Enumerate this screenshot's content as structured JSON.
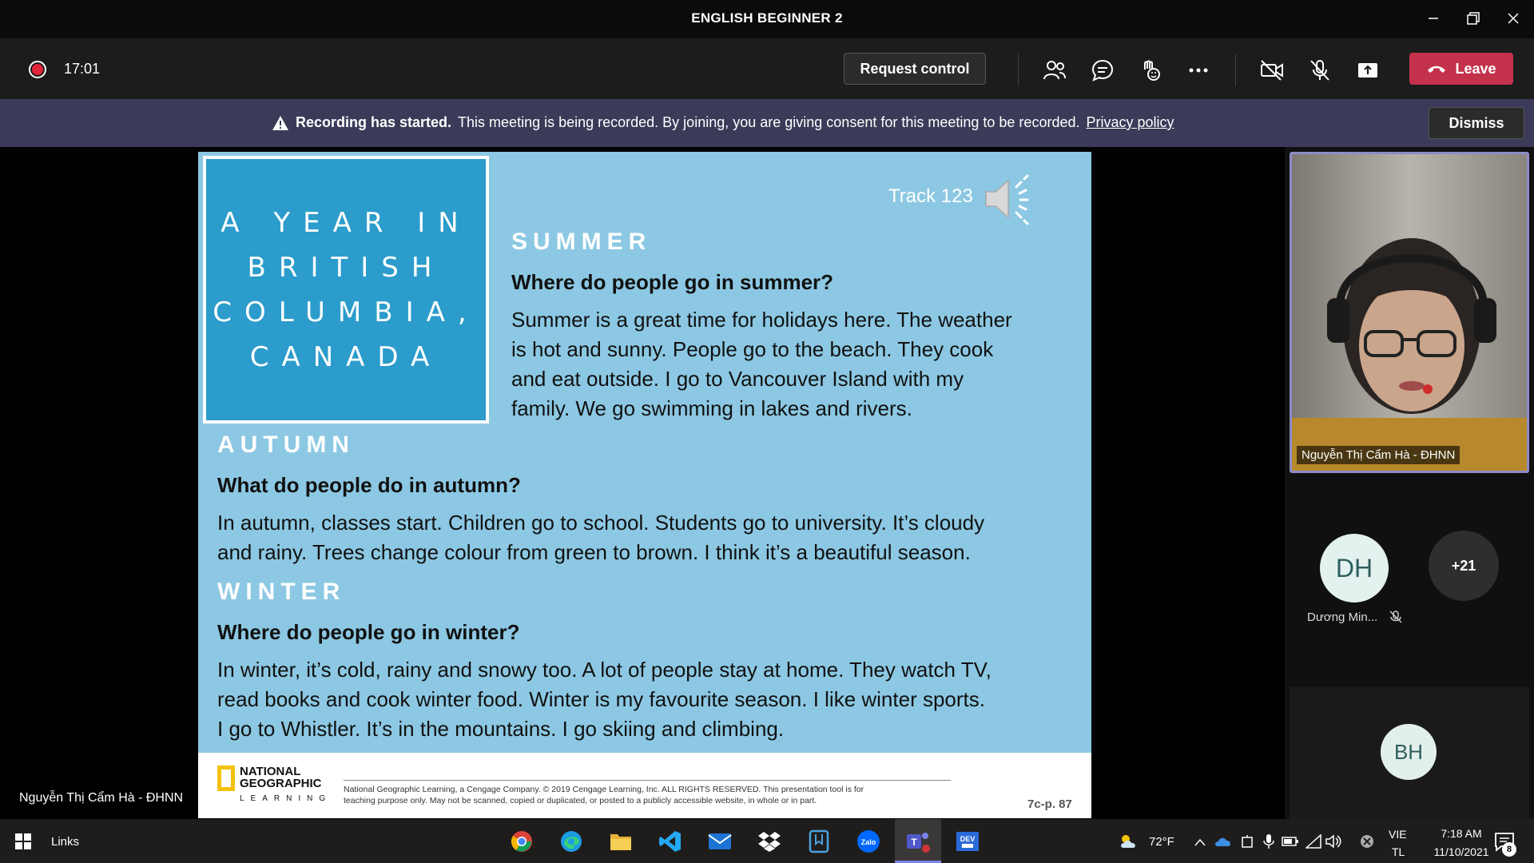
{
  "window": {
    "title": "ENGLISH BEGINNER 2"
  },
  "toolbar": {
    "timer": "17:01",
    "request_control_label": "Request control",
    "leave_label": "Leave"
  },
  "banner": {
    "bold": "Recording has started.",
    "text": "This meeting is being recorded. By joining, you are giving consent for this meeting to be recorded.",
    "link": "Privacy policy",
    "dismiss_label": "Dismiss"
  },
  "slide": {
    "title_lines": [
      "A YEAR IN",
      "BRITISH",
      "COLUMBIA,",
      "CANADA"
    ],
    "track": "Track 123",
    "summer": {
      "heading": "SUMMER",
      "question": "Where do people go in summer?",
      "lines": [
        "Summer is a great time for holidays here. The weather",
        "is hot and sunny. People go to the beach. They cook",
        "and eat outside. I go to Vancouver Island with my",
        "family. We go swimming in lakes and rivers."
      ]
    },
    "autumn": {
      "heading": "AUTUMN",
      "question": "What do people do in autumn?",
      "lines": [
        "In autumn, classes start. Children go to school. Students go to university. It’s cloudy",
        "and rainy. Trees change colour from green to brown. I think it’s a beautiful season."
      ]
    },
    "winter": {
      "heading": "WINTER",
      "question": "Where do people go in winter?",
      "lines": [
        "In winter, it’s cold, rainy and snowy too. A lot of people stay at home. They watch TV,",
        "read books and cook winter food. Winter is my favourite season. I like winter sports.",
        "I go to Whistler. It’s in the mountains. I go skiing and climbing."
      ]
    },
    "footer": {
      "logo_line1": "NATIONAL",
      "logo_line2": "GEOGRAPHIC",
      "logo_line3": "LEARNING",
      "copyright_1": "National Geographic Learning, a Cengage Company. © 2019 Cengage Learning, Inc. ALL RIGHTS RESERVED. This presentation tool is for",
      "copyright_2": "teaching purpose only. May not be scanned, copied or duplicated, or posted to a publicly accessible website, in whole or in part.",
      "page_ref": "7c-p. 87"
    }
  },
  "presenter_name": "Nguyễn Thị Cẩm Hà - ĐHNN",
  "participants": {
    "video_name": "Nguyễn Thị Cẩm Hà - ĐHNN",
    "avatar1_initials": "DH",
    "avatar1_name": "Dương Min...",
    "more_count": "+21",
    "avatar2_initials": "BH"
  },
  "taskbar": {
    "links_label": "Links",
    "weather": "72°F",
    "lang_1": "VIE",
    "lang_2": "TL",
    "time": "7:18 AM",
    "date": "11/10/2021",
    "notification_count": "8"
  },
  "colors": {
    "leave": "#c4314b",
    "banner": "#3b3b59",
    "slide_bg": "#8cc8e3",
    "title_box": "#2b9ccb",
    "avatar_bg": "#e3f1ef"
  }
}
